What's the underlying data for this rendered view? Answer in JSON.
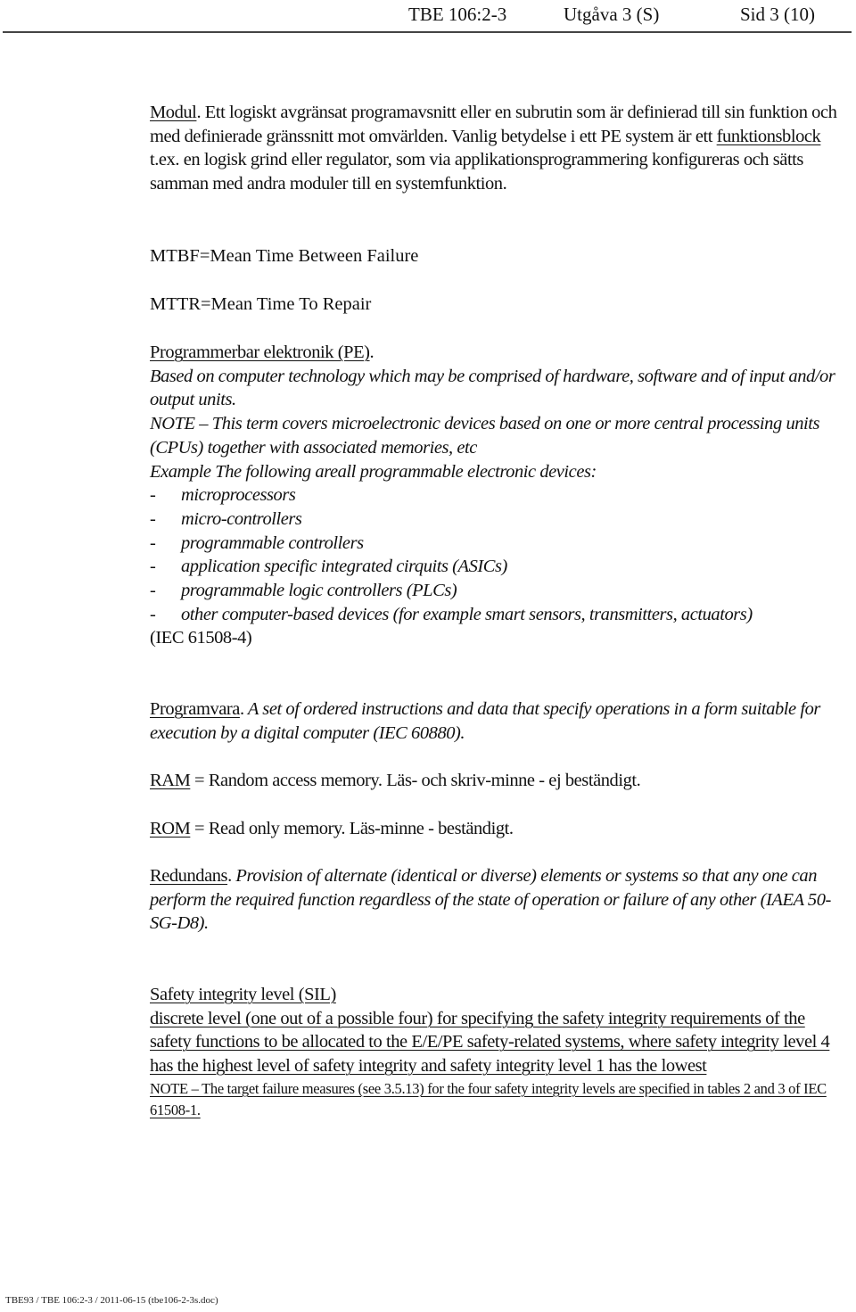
{
  "header": {
    "doc_id": "TBE 106:2-3",
    "edition": "Utgåva 3 (S)",
    "page": "Sid 3 (10)"
  },
  "modul": {
    "term": "Modul",
    "p1": ". Ett logiskt avgränsat programavsnitt eller en subrutin som är definierad till sin funktion och med definierade gränssnitt mot omvärlden. Vanlig betydelse i ett PE system är ett ",
    "link_term": "funktionsblock",
    "p2": " t.ex. en logisk grind eller regulator, som via applikationsprogrammering konfigureras och sätts samman med andra moduler till en systemfunktion."
  },
  "mtbf": "MTBF=Mean Time Between Failure",
  "mttr": "MTTR=Mean Time To Repair",
  "pe": {
    "term": "Programmerbar elektronik (PE)",
    "term_end": ".",
    "definition": "Based on computer technology which may be comprised of hardware, software and of input and/or output units.",
    "note": "NOTE – This term covers microelectronic devices based on one or more central processing units (CPUs) together with associated memories, etc",
    "example_intro": "Example The following areall programmable electronic devices:",
    "dash": "-",
    "examples": [
      "microprocessors",
      "micro-controllers",
      "programmable controllers",
      "application specific integrated cirquits (ASICs)",
      "programmable logic controllers (PLCs)",
      "other computer-based devices (for example smart sensors, transmitters, actuators)"
    ],
    "reference": "(IEC 61508-4)"
  },
  "programvara": {
    "term": "Programvara",
    "term_end": ".",
    "definition": " A set of ordered instructions and data that specify operations in a form suitable for execution by a digital computer (IEC 60880)."
  },
  "ram": {
    "term": "RAM",
    "definition": " = Random access memory. Läs- och skriv-minne - ej beständigt."
  },
  "rom": {
    "term": "ROM",
    "definition": " = Read only memory. Läs-minne - beständigt."
  },
  "redundans": {
    "term": "Redundans",
    "term_end": ".",
    "definition": " Provision of alternate (identical or diverse) elements or systems so that any one can perform the required function regardless of the state of operation or failure of any other (IAEA 50-SG-D8)."
  },
  "sil": {
    "title": "Safety integrity level (SIL)",
    "definition": "discrete level (one out of a possible four) for specifying the safety integrity requirements of the safety functions to be allocated to the E/E/PE safety-related systems, where safety integrity level 4 has the highest level of safety integrity and safety integrity level 1 has the lowest",
    "note": "NOTE – The target failure measures (see 3.5.13) for the four safety integrity levels are specified in tables 2 and 3 of IEC 61508-1."
  },
  "footer": "TBE93 / TBE 106:2-3 / 2011-06-15 (tbe106-2-3s.doc)"
}
